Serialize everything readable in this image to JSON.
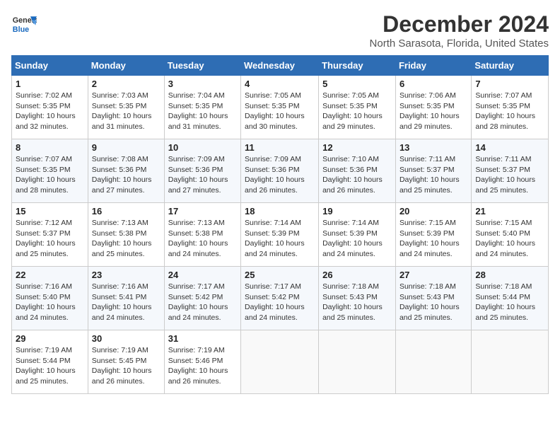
{
  "header": {
    "logo_line1": "General",
    "logo_line2": "Blue",
    "month_title": "December 2024",
    "location": "North Sarasota, Florida, United States"
  },
  "days_of_week": [
    "Sunday",
    "Monday",
    "Tuesday",
    "Wednesday",
    "Thursday",
    "Friday",
    "Saturday"
  ],
  "weeks": [
    [
      {
        "day": "1",
        "rise": "7:02 AM",
        "set": "5:35 PM",
        "daylight": "10 hours and 32 minutes."
      },
      {
        "day": "2",
        "rise": "7:03 AM",
        "set": "5:35 PM",
        "daylight": "10 hours and 31 minutes."
      },
      {
        "day": "3",
        "rise": "7:04 AM",
        "set": "5:35 PM",
        "daylight": "10 hours and 31 minutes."
      },
      {
        "day": "4",
        "rise": "7:05 AM",
        "set": "5:35 PM",
        "daylight": "10 hours and 30 minutes."
      },
      {
        "day": "5",
        "rise": "7:05 AM",
        "set": "5:35 PM",
        "daylight": "10 hours and 29 minutes."
      },
      {
        "day": "6",
        "rise": "7:06 AM",
        "set": "5:35 PM",
        "daylight": "10 hours and 29 minutes."
      },
      {
        "day": "7",
        "rise": "7:07 AM",
        "set": "5:35 PM",
        "daylight": "10 hours and 28 minutes."
      }
    ],
    [
      {
        "day": "8",
        "rise": "7:07 AM",
        "set": "5:35 PM",
        "daylight": "10 hours and 28 minutes."
      },
      {
        "day": "9",
        "rise": "7:08 AM",
        "set": "5:36 PM",
        "daylight": "10 hours and 27 minutes."
      },
      {
        "day": "10",
        "rise": "7:09 AM",
        "set": "5:36 PM",
        "daylight": "10 hours and 27 minutes."
      },
      {
        "day": "11",
        "rise": "7:09 AM",
        "set": "5:36 PM",
        "daylight": "10 hours and 26 minutes."
      },
      {
        "day": "12",
        "rise": "7:10 AM",
        "set": "5:36 PM",
        "daylight": "10 hours and 26 minutes."
      },
      {
        "day": "13",
        "rise": "7:11 AM",
        "set": "5:37 PM",
        "daylight": "10 hours and 25 minutes."
      },
      {
        "day": "14",
        "rise": "7:11 AM",
        "set": "5:37 PM",
        "daylight": "10 hours and 25 minutes."
      }
    ],
    [
      {
        "day": "15",
        "rise": "7:12 AM",
        "set": "5:37 PM",
        "daylight": "10 hours and 25 minutes."
      },
      {
        "day": "16",
        "rise": "7:13 AM",
        "set": "5:38 PM",
        "daylight": "10 hours and 25 minutes."
      },
      {
        "day": "17",
        "rise": "7:13 AM",
        "set": "5:38 PM",
        "daylight": "10 hours and 24 minutes."
      },
      {
        "day": "18",
        "rise": "7:14 AM",
        "set": "5:39 PM",
        "daylight": "10 hours and 24 minutes."
      },
      {
        "day": "19",
        "rise": "7:14 AM",
        "set": "5:39 PM",
        "daylight": "10 hours and 24 minutes."
      },
      {
        "day": "20",
        "rise": "7:15 AM",
        "set": "5:39 PM",
        "daylight": "10 hours and 24 minutes."
      },
      {
        "day": "21",
        "rise": "7:15 AM",
        "set": "5:40 PM",
        "daylight": "10 hours and 24 minutes."
      }
    ],
    [
      {
        "day": "22",
        "rise": "7:16 AM",
        "set": "5:40 PM",
        "daylight": "10 hours and 24 minutes."
      },
      {
        "day": "23",
        "rise": "7:16 AM",
        "set": "5:41 PM",
        "daylight": "10 hours and 24 minutes."
      },
      {
        "day": "24",
        "rise": "7:17 AM",
        "set": "5:42 PM",
        "daylight": "10 hours and 24 minutes."
      },
      {
        "day": "25",
        "rise": "7:17 AM",
        "set": "5:42 PM",
        "daylight": "10 hours and 24 minutes."
      },
      {
        "day": "26",
        "rise": "7:18 AM",
        "set": "5:43 PM",
        "daylight": "10 hours and 25 minutes."
      },
      {
        "day": "27",
        "rise": "7:18 AM",
        "set": "5:43 PM",
        "daylight": "10 hours and 25 minutes."
      },
      {
        "day": "28",
        "rise": "7:18 AM",
        "set": "5:44 PM",
        "daylight": "10 hours and 25 minutes."
      }
    ],
    [
      {
        "day": "29",
        "rise": "7:19 AM",
        "set": "5:44 PM",
        "daylight": "10 hours and 25 minutes."
      },
      {
        "day": "30",
        "rise": "7:19 AM",
        "set": "5:45 PM",
        "daylight": "10 hours and 26 minutes."
      },
      {
        "day": "31",
        "rise": "7:19 AM",
        "set": "5:46 PM",
        "daylight": "10 hours and 26 minutes."
      },
      null,
      null,
      null,
      null
    ]
  ],
  "labels": {
    "sunrise": "Sunrise:",
    "sunset": "Sunset:",
    "daylight": "Daylight:"
  }
}
